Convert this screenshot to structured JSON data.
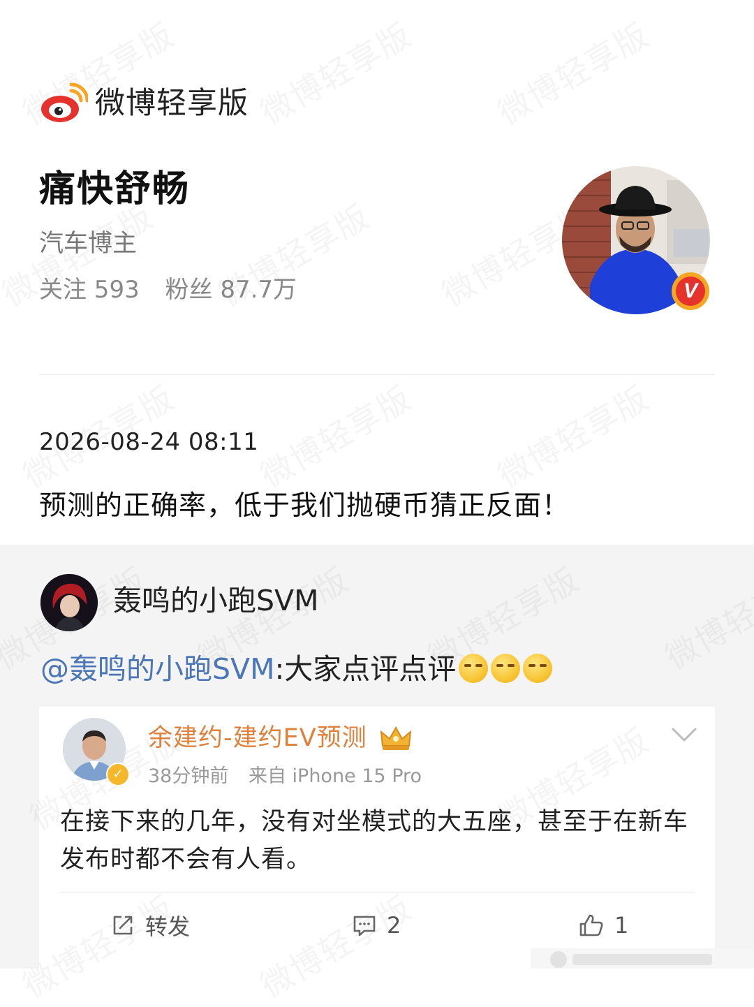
{
  "app": {
    "name": "微博轻享版",
    "watermark": "微博轻享版"
  },
  "profile": {
    "name": "痛快舒畅",
    "role": "汽车博主",
    "following_label": "关注 593",
    "followers_label": "粉丝 87.7万"
  },
  "post": {
    "time": "2026-08-24 08:11",
    "text": "预测的正确率，低于我们抛硬币猜正反面！"
  },
  "repost": {
    "user": "轰鸣的小跑SVM",
    "mention": "@轰鸣的小跑SVM",
    "text": ":大家点评点评"
  },
  "original": {
    "author": "余建约-建约EV预测",
    "time": "38分钟前",
    "source": "来自 iPhone 15 Pro",
    "text": "在接下来的几年，没有对坐模式的大五座，甚至于在新车发布时都不会有人看。",
    "actions": {
      "repost": "转发",
      "comments": "2",
      "likes": "1"
    }
  },
  "colors": {
    "accent_link": "#4a76b8",
    "author_gold": "#e0803a",
    "weibo_red": "#e6322c"
  }
}
